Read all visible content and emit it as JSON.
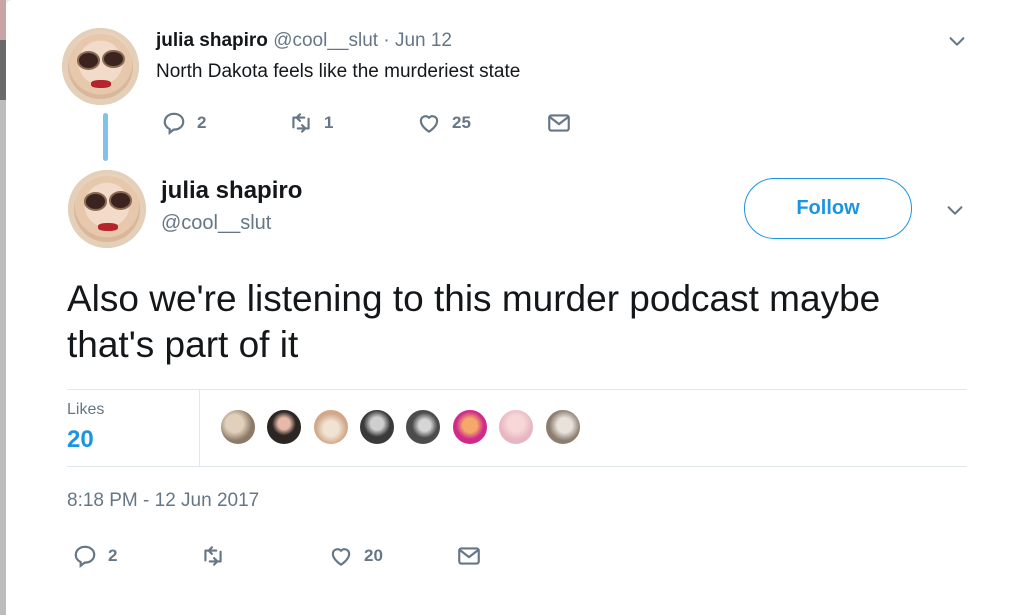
{
  "colors": {
    "accent": "#1b95e0",
    "thread": "#7fc4e8",
    "muted": "#657786"
  },
  "parent_tweet": {
    "display_name": "julia shapiro",
    "handle": "@cool__slut",
    "separator": "·",
    "date": "Jun 12",
    "text": "North Dakota feels like the murderiest state",
    "actions": {
      "reply_count": "2",
      "retweet_count": "1",
      "like_count": "25"
    },
    "icons": [
      "reply-icon",
      "retweet-icon",
      "heart-icon",
      "message-icon",
      "chevron-down-icon"
    ]
  },
  "main_tweet": {
    "display_name": "julia shapiro",
    "handle": "@cool__slut",
    "follow_label": "Follow",
    "text": "Also we're listening to this murder podcast maybe that's part of it",
    "likes_label": "Likes",
    "likes_count": "20",
    "likers": [
      "#8a7a66",
      "#2b2524",
      "#d1a98a",
      "#3a3a3a",
      "#4c4c4c",
      "#d02a8a",
      "#e7b7c1",
      "#8c7d70"
    ],
    "timestamp": "8:18 PM - 12 Jun 2017",
    "actions": {
      "reply_count": "2",
      "retweet_count": "",
      "like_count": "20"
    }
  }
}
